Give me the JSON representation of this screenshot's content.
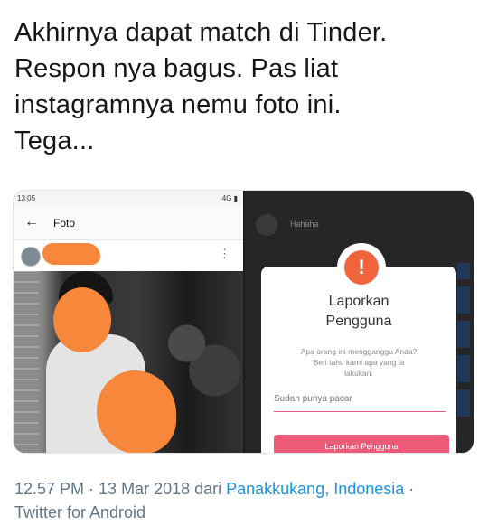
{
  "tweet": {
    "text": "Akhirnya dapat match di Tinder.\nRespon nya bagus. Pas liat\ninstagramnya nemu foto ini.\nTega..."
  },
  "left_screen": {
    "status_time": "13:05",
    "status_signal": "4G",
    "back_icon": "arrow-left-icon",
    "title": "Foto",
    "menu_icon": "more-vertical-icon"
  },
  "right_screen": {
    "chat_message": "Hahaha",
    "dialog": {
      "icon": "shield-alert-icon",
      "title": "Laporkan\nPengguna",
      "body": "Apa orang ini mengganggu Anda?\nBeri tahu kami apa yang ia\nlakukan.",
      "input_value": "Sudah punya pacar",
      "button_label": "Laporkan Pengguna"
    }
  },
  "meta": {
    "time_date": "12.57 PM · 13 Mar 2018 dari ",
    "location": "Panakkukang, Indonesia",
    "sep": " ·",
    "source": "Twitter for Android"
  },
  "colors": {
    "accent_orange": "#f7873a",
    "tinder_red": "#f2643e",
    "button_pink": "#ee5b78",
    "link_blue": "#1b95e0",
    "meta_gray": "#657786"
  }
}
